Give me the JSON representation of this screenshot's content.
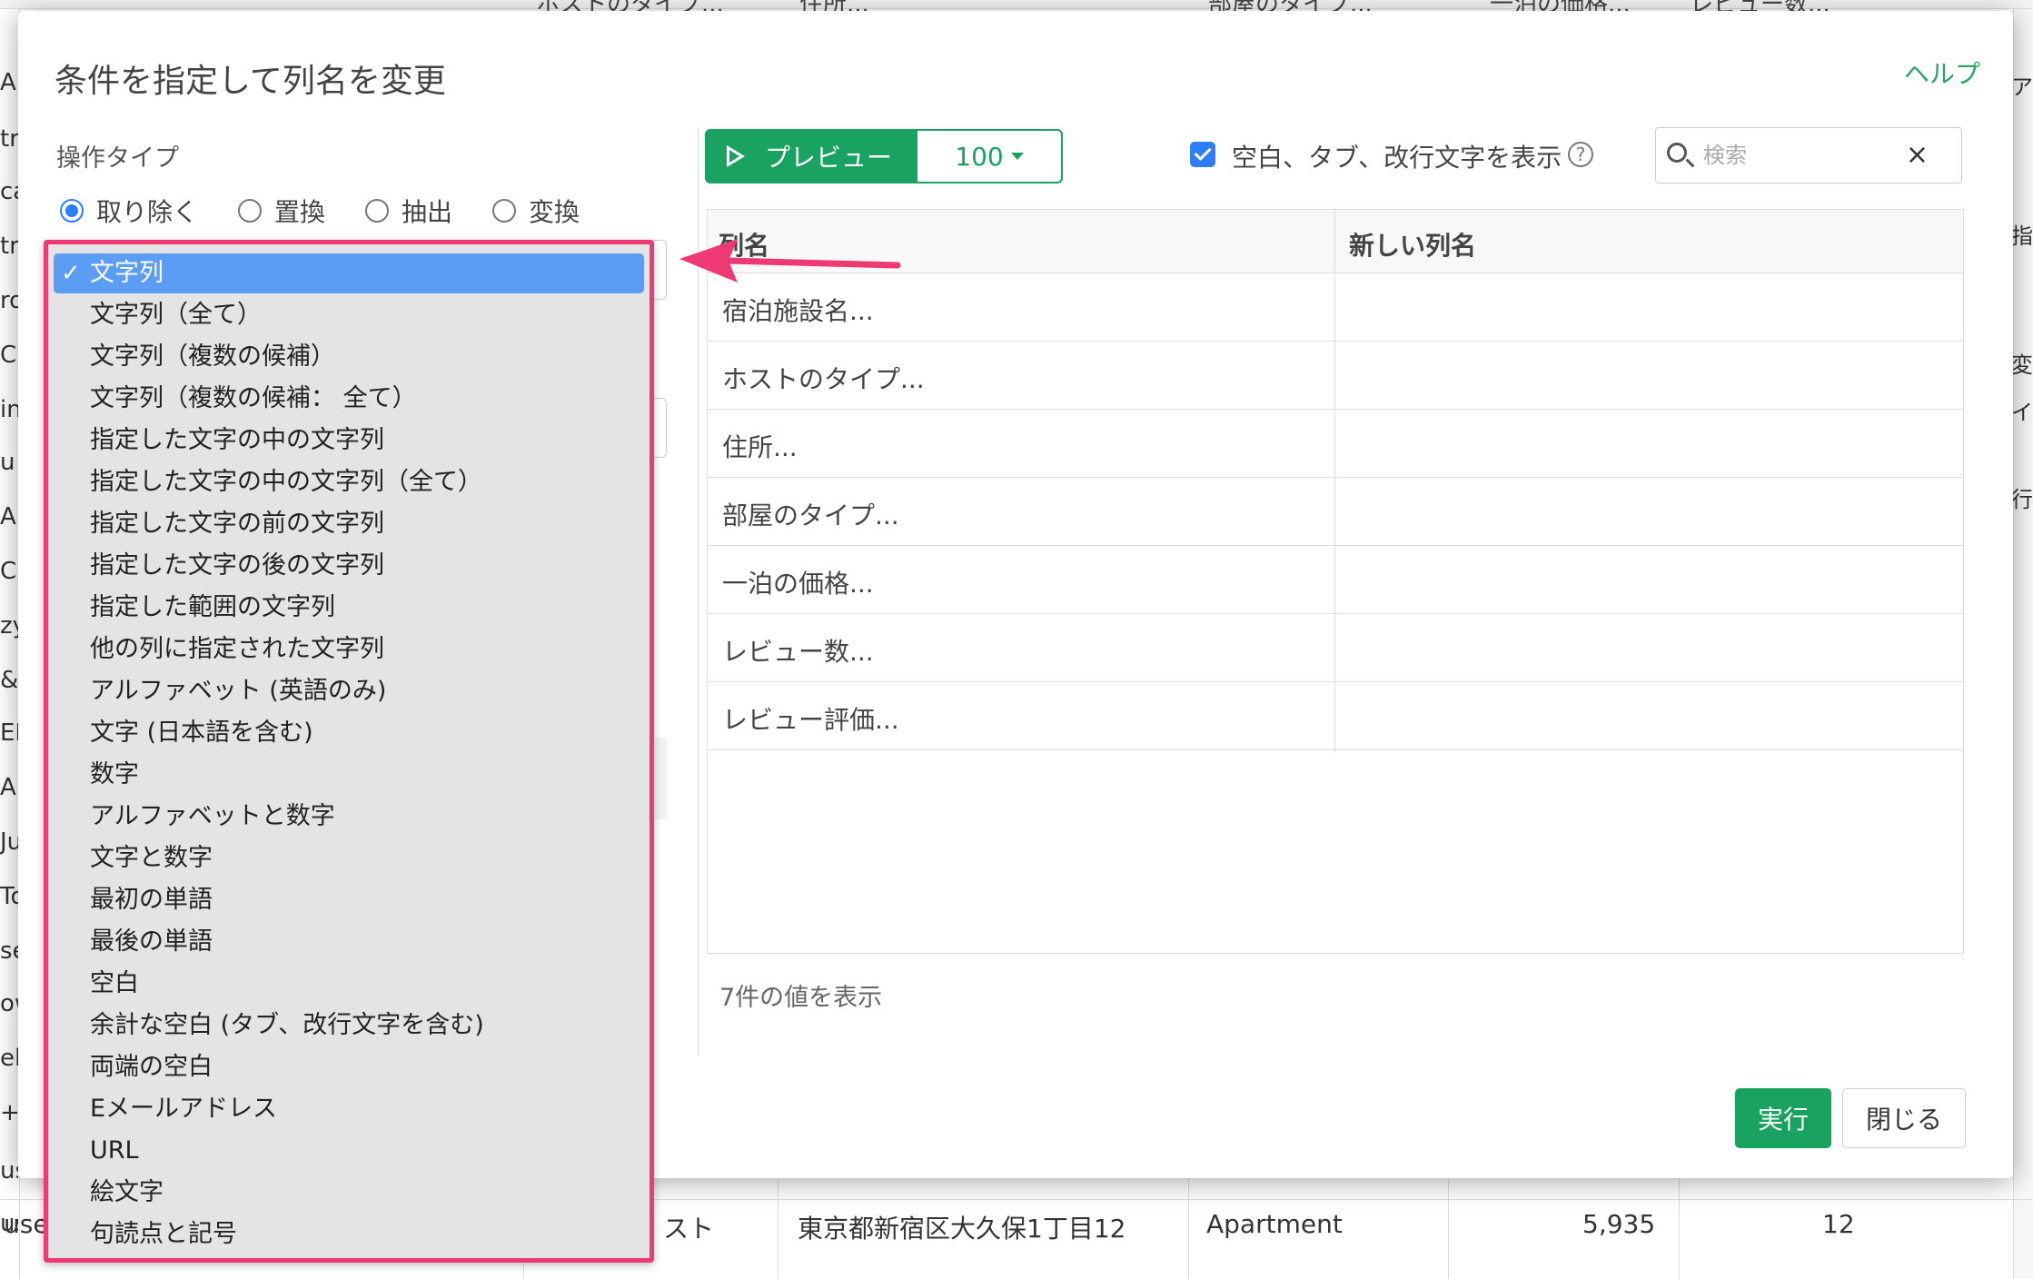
{
  "background": {
    "col_headers": [
      "ホストのタイプ...",
      "住所...",
      "部屋のタイプ...",
      "一泊の価格...",
      "レビュー数..."
    ],
    "left_fragments": [
      "Ap",
      "tra",
      "ca",
      "tra",
      "ro",
      "CS",
      "in",
      "u",
      "A",
      "C",
      "zy",
      "&",
      "EN",
      "A",
      "Ju",
      "To",
      "se",
      "ow",
      "el",
      "+",
      "us",
      "use"
    ],
    "right_fragments": [
      "ア",
      "指",
      "変",
      "イ",
      "行"
    ],
    "rows": [
      {
        "name": "use",
        "host": "スト",
        "address": "東京都新宿区大久保1丁目12",
        "room": "Apartment",
        "price": "5,935",
        "reviews": "12"
      }
    ]
  },
  "modal": {
    "title": "条件を指定して列名を変更",
    "help": "ヘルプ",
    "operation_type_label": "操作タイプ",
    "operation_types": [
      {
        "label": "取り除く",
        "checked": true
      },
      {
        "label": "置換",
        "checked": false
      },
      {
        "label": "抽出",
        "checked": false
      },
      {
        "label": "変換",
        "checked": false
      }
    ],
    "preview": {
      "button_label": "プレビュー",
      "count": "100",
      "show_whitespace_label": "空白、タブ、改行文字を表示",
      "show_whitespace_checked": true,
      "help_glyph": "?",
      "search_placeholder": "検索",
      "columns": [
        "列名",
        "新しい列名"
      ],
      "rows": [
        "宿泊施設名...",
        "ホストのタイプ...",
        "住所...",
        "部屋のタイプ...",
        "一泊の価格...",
        "レビュー数...",
        "レビュー評価..."
      ],
      "shown_count": "7件の値を表示"
    },
    "run_label": "実行",
    "close_label": "閉じる"
  },
  "dropdown": {
    "selected": "文字列",
    "options": [
      "文字列",
      "文字列（全て）",
      "文字列（複数の候補）",
      "文字列（複数の候補： 全て）",
      "指定した文字の中の文字列",
      "指定した文字の中の文字列（全て）",
      "指定した文字の前の文字列",
      "指定した文字の後の文字列",
      "指定した範囲の文字列",
      "他の列に指定された文字列",
      "アルファベット (英語のみ)",
      "文字 (日本語を含む)",
      "数字",
      "アルファベットと数字",
      "文字と数字",
      "最初の単語",
      "最後の単語",
      "空白",
      "余計な空白 (タブ、改行文字を含む)",
      "両端の空白",
      "Eメールアドレス",
      "URL",
      "絵文字",
      "句読点と記号"
    ]
  },
  "colors": {
    "accent_green": "#1aa260",
    "selection_blue": "#5b9df4",
    "highlight_pink": "#ee3a74"
  }
}
